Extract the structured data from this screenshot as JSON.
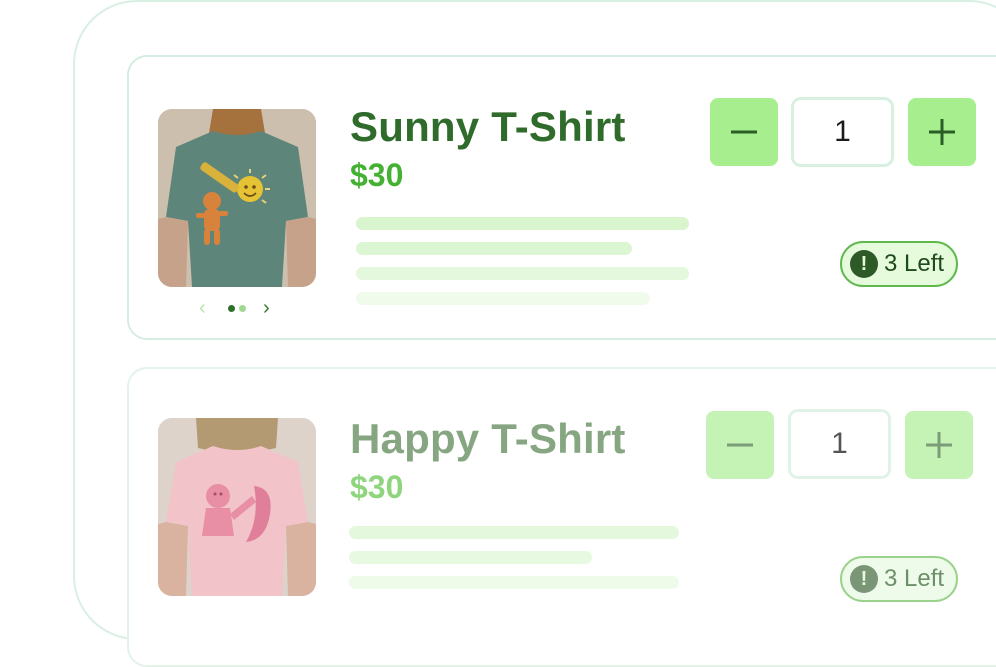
{
  "colors": {
    "accent_dark": "#2f6b2a",
    "accent_price": "#44b132",
    "button_fill": "#a6ee8e",
    "border_soft": "#d5eee0"
  },
  "products": [
    {
      "title": "Sunny T-Shirt",
      "price": "$30",
      "quantity": "1",
      "stock": "3 Left",
      "image": "green-tshirt-sun-drawing"
    },
    {
      "title": "Happy T-Shirt",
      "price": "$30",
      "quantity": "1",
      "stock": "3 Left",
      "image": "pink-tshirt-friends-drawing"
    }
  ],
  "icons": {
    "prev": "chevron-left-icon",
    "next": "chevron-right-icon",
    "minus": "minus-icon",
    "plus": "plus-icon",
    "alert": "exclamation-icon"
  }
}
